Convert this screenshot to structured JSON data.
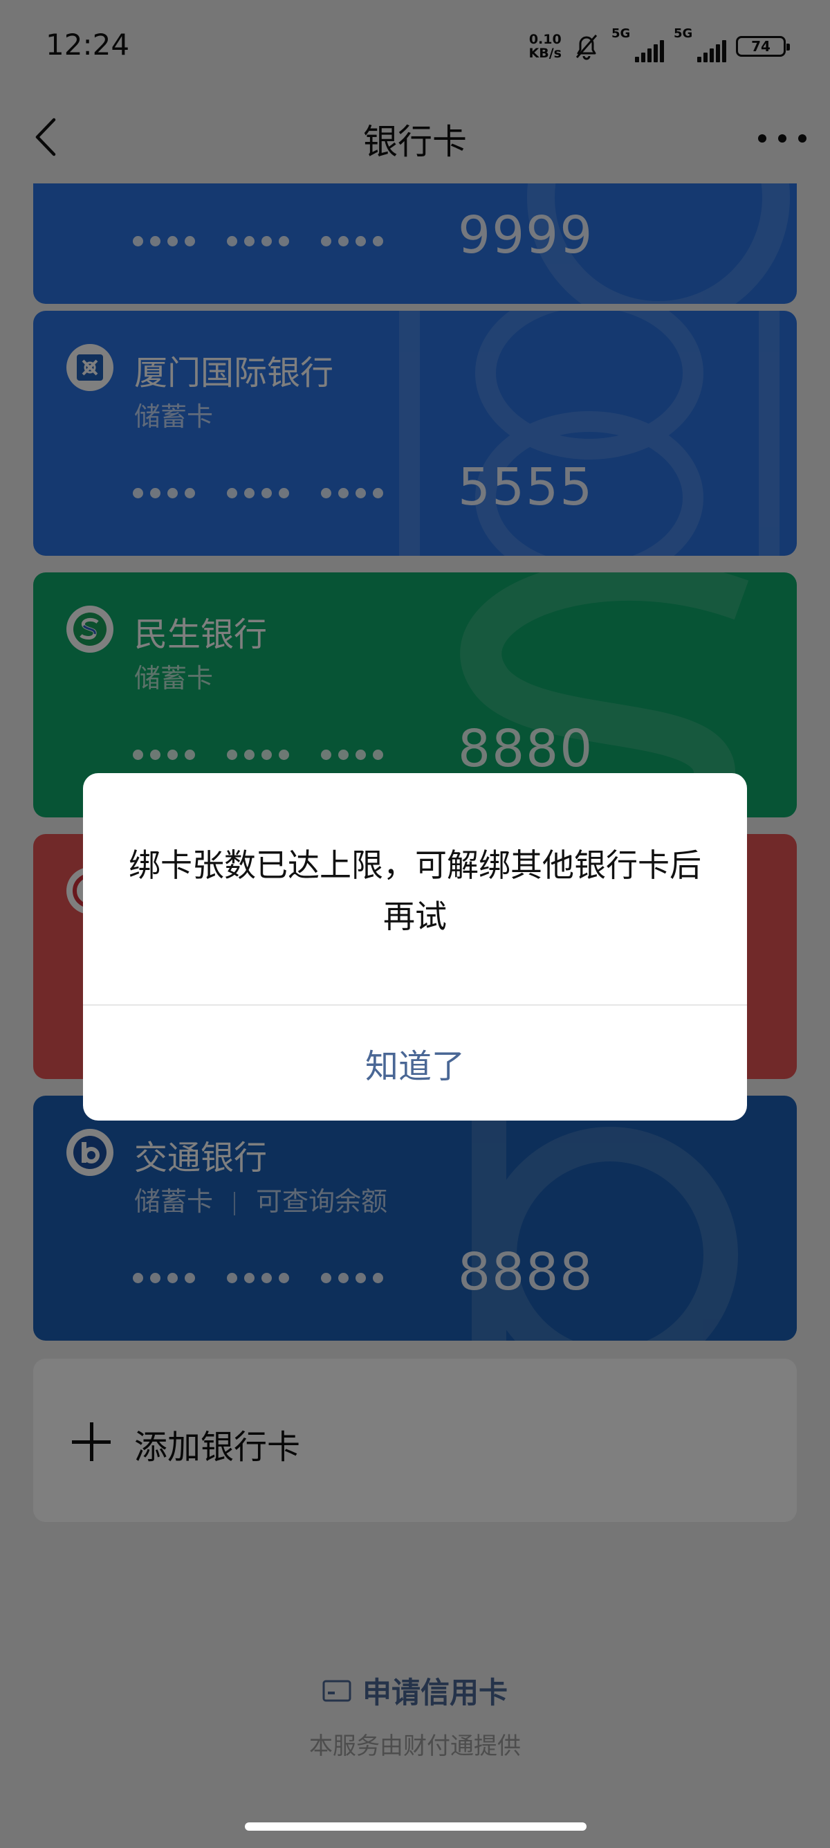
{
  "status_bar": {
    "time": "12:24",
    "net_speed_value": "0.10",
    "net_speed_unit": "KB/s",
    "signal1_tag": "5G",
    "signal2_tag": "5G",
    "battery": "74"
  },
  "nav": {
    "title": "银行卡"
  },
  "cards": [
    {
      "bank_name": "",
      "card_type": "",
      "last4": "9999",
      "color": "#2a73e0"
    },
    {
      "bank_name": "厦门国际银行",
      "card_type": "储蓄卡",
      "last4": "5555",
      "color": "#2a73e0"
    },
    {
      "bank_name": "民生银行",
      "card_type": "储蓄卡",
      "last4": "8880",
      "color": "#0fa86a"
    },
    {
      "bank_name": "",
      "card_type": "",
      "last4": "",
      "color": "#e35352"
    },
    {
      "bank_name": "交通银行",
      "card_type": "储蓄卡",
      "card_extra": "可查询余额",
      "last4": "8888",
      "color": "#1b5fb4"
    }
  ],
  "add_card": {
    "label": "添加银行卡"
  },
  "footer": {
    "apply_credit": "申请信用卡",
    "provider": "本服务由财付通提供"
  },
  "dialog": {
    "message": "绑卡张数已达上限，可解绑其他银行卡后再试",
    "button": "知道了"
  }
}
